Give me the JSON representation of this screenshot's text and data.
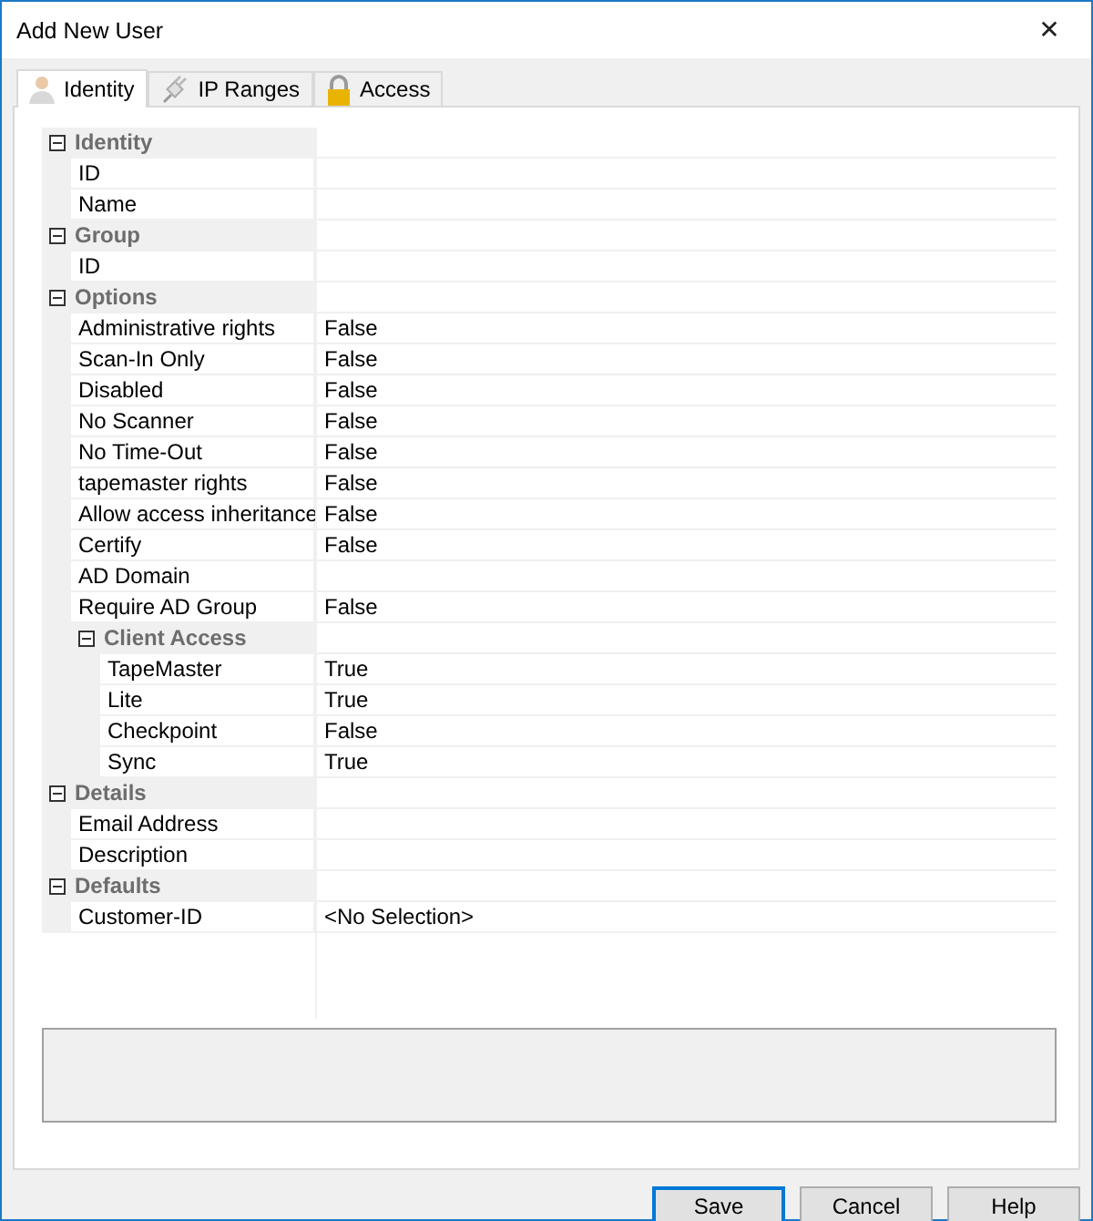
{
  "window": {
    "title": "Add New User",
    "close": "✕"
  },
  "tabs": [
    {
      "label": "Identity",
      "selected": true
    },
    {
      "label": "IP Ranges",
      "selected": false
    },
    {
      "label": "Access",
      "selected": false
    }
  ],
  "property_grid": [
    {
      "kind": "category",
      "label": "Identity",
      "expanded": true,
      "children": [
        {
          "kind": "property",
          "label": "ID"
        },
        {
          "kind": "property",
          "label": "Name"
        }
      ]
    },
    {
      "kind": "category",
      "label": "Group",
      "expanded": true,
      "children": [
        {
          "kind": "property",
          "label": "ID"
        }
      ]
    },
    {
      "kind": "category",
      "label": "Options",
      "expanded": true,
      "children": [
        {
          "kind": "property",
          "label": "Administrative rights",
          "value": "False"
        },
        {
          "kind": "property",
          "label": "Scan-In Only",
          "value": "False"
        },
        {
          "kind": "property",
          "label": "Disabled",
          "value": "False"
        },
        {
          "kind": "property",
          "label": "No Scanner",
          "value": "False"
        },
        {
          "kind": "property",
          "label": "No Time-Out",
          "value": "False"
        },
        {
          "kind": "property",
          "label": "tapemaster rights",
          "value": "False"
        },
        {
          "kind": "property",
          "label": "Allow access inheritance",
          "value": "False"
        },
        {
          "kind": "property",
          "label": "Certify",
          "value": "False"
        },
        {
          "kind": "property",
          "label": "AD Domain"
        },
        {
          "kind": "property",
          "label": "Require AD Group",
          "value": "False"
        },
        {
          "kind": "category",
          "label": "Client Access",
          "expanded": true,
          "children": [
            {
              "kind": "property",
              "label": "TapeMaster",
              "value": "True"
            },
            {
              "kind": "property",
              "label": "Lite",
              "value": "True"
            },
            {
              "kind": "property",
              "label": "Checkpoint",
              "value": "False"
            },
            {
              "kind": "property",
              "label": "Sync",
              "value": "True"
            }
          ]
        }
      ]
    },
    {
      "kind": "category",
      "label": "Details",
      "expanded": true,
      "children": [
        {
          "kind": "property",
          "label": "Email Address"
        },
        {
          "kind": "property",
          "label": "Description"
        }
      ]
    },
    {
      "kind": "category",
      "label": "Defaults",
      "expanded": true,
      "children": [
        {
          "kind": "property",
          "label": "Customer-ID",
          "value": "<No Selection>"
        }
      ]
    }
  ],
  "buttons": [
    {
      "label": "Save",
      "default": true
    },
    {
      "label": "Cancel",
      "default": false
    },
    {
      "label": "Help",
      "default": false
    }
  ]
}
